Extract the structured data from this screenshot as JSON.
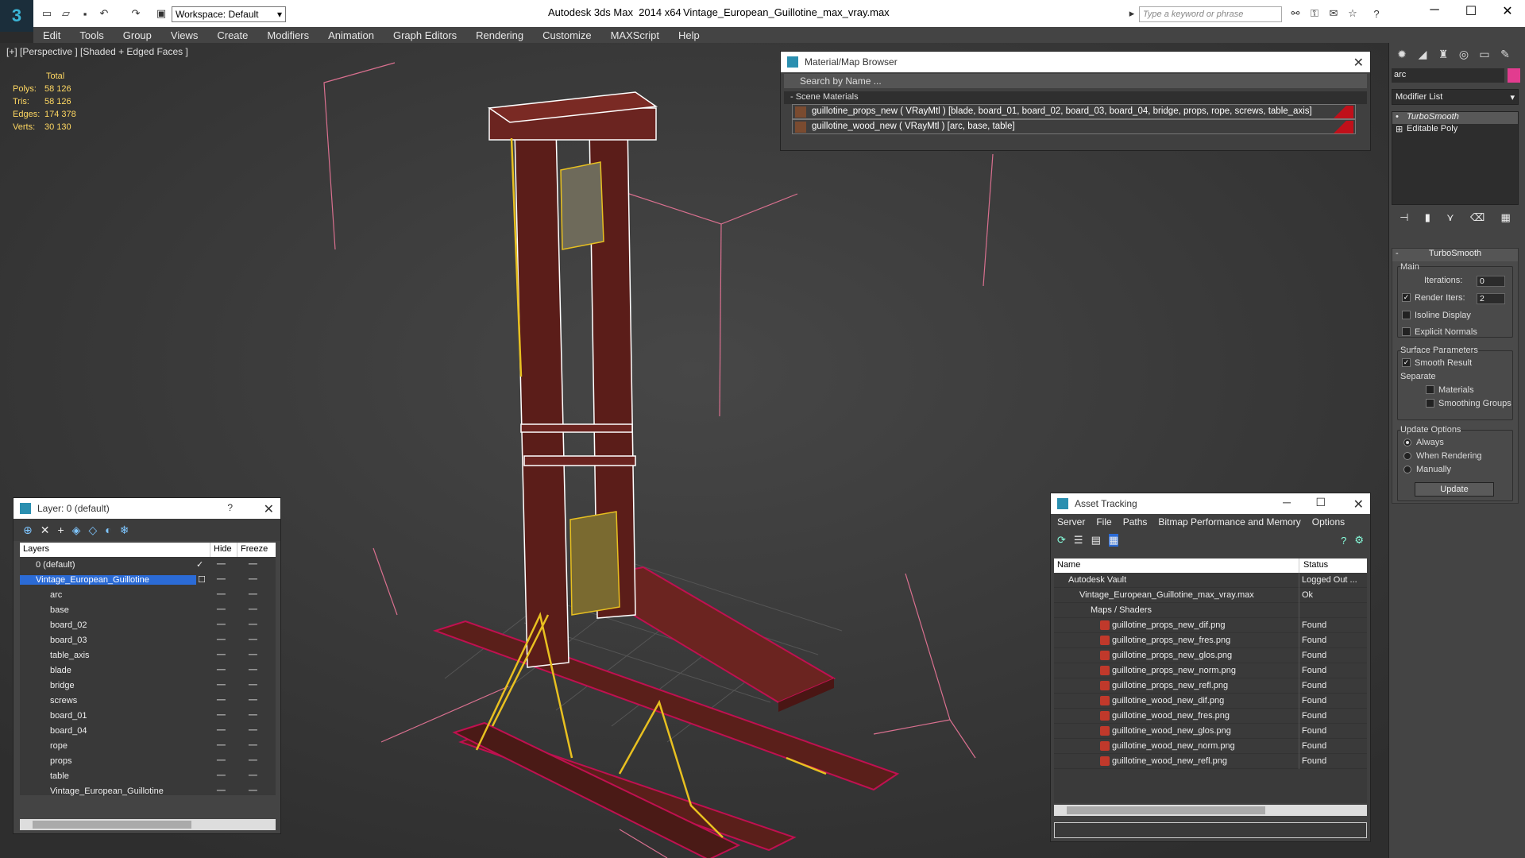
{
  "app": {
    "title": "Autodesk 3ds Max  2014 x64",
    "file": "Vintage_European_Guillotine_max_vray.max",
    "workspace": "Workspace: Default",
    "search_placeholder": "Type a keyword or phrase"
  },
  "menu": [
    "Edit",
    "Tools",
    "Group",
    "Views",
    "Create",
    "Modifiers",
    "Animation",
    "Graph Editors",
    "Rendering",
    "Customize",
    "MAXScript",
    "Help"
  ],
  "viewport": {
    "label": "[+] [Perspective ] [Shaded + Edged Faces ]",
    "stats": {
      "header": "Total",
      "rows": [
        {
          "k": "Polys:",
          "v": "58 126"
        },
        {
          "k": "Tris:",
          "v": "58 126"
        },
        {
          "k": "Edges:",
          "v": "174 378"
        },
        {
          "k": "Verts:",
          "v": "30 130"
        }
      ]
    }
  },
  "material_browser": {
    "title": "Material/Map Browser",
    "search": "Search by Name ...",
    "section": "- Scene Materials",
    "materials": [
      "guillotine_props_new  ( VRayMtl ) [blade, board_01, board_02, board_03, board_04, bridge, props, rope, screws, table_axis]",
      "guillotine_wood_new  ( VRayMtl ) [arc, base, table]"
    ]
  },
  "command_panel": {
    "object_name": "arc",
    "modifier_list": "Modifier List",
    "stack": [
      "TurboSmooth",
      "Editable Poly"
    ],
    "rollout_title": "TurboSmooth",
    "main_label": "Main",
    "iterations_label": "Iterations:",
    "iterations": "0",
    "render_iters_label": "Render Iters:",
    "render_iters": "2",
    "isoline": "Isoline Display",
    "explicit": "Explicit Normals",
    "surface_label": "Surface Parameters",
    "smooth_result": "Smooth Result",
    "separate_label": "Separate",
    "materials": "Materials",
    "smoothing_groups": "Smoothing Groups",
    "update_label": "Update Options",
    "always": "Always",
    "when_rendering": "When Rendering",
    "manually": "Manually",
    "update_button": "Update"
  },
  "layer_dialog": {
    "title": "Layer: 0 (default)",
    "help": "?",
    "col_layers": "Layers",
    "col_hide": "Hide",
    "col_freeze": "Freeze",
    "rows": [
      {
        "name": "0 (default)",
        "level": "top"
      },
      {
        "name": "Vintage_European_Guillotine",
        "level": "top",
        "selected": true
      },
      {
        "name": "arc"
      },
      {
        "name": "base"
      },
      {
        "name": "board_02"
      },
      {
        "name": "board_03"
      },
      {
        "name": "table_axis"
      },
      {
        "name": "blade"
      },
      {
        "name": "bridge"
      },
      {
        "name": "screws"
      },
      {
        "name": "board_01"
      },
      {
        "name": "board_04"
      },
      {
        "name": "rope"
      },
      {
        "name": "props"
      },
      {
        "name": "table"
      },
      {
        "name": "Vintage_European_Guillotine"
      }
    ]
  },
  "asset_tracking": {
    "title": "Asset Tracking",
    "menu": [
      "Server",
      "File",
      "Paths",
      "Bitmap Performance and Memory",
      "Options"
    ],
    "col_name": "Name",
    "col_status": "Status",
    "rows": [
      {
        "name": "Autodesk Vault",
        "status": "Logged Out ...",
        "indent": 18
      },
      {
        "name": "Vintage_European_Guillotine_max_vray.max",
        "status": "Ok",
        "indent": 32
      },
      {
        "name": "Maps / Shaders",
        "status": "",
        "indent": 46
      },
      {
        "name": "guillotine_props_new_dif.png",
        "status": "Found",
        "indent": 58
      },
      {
        "name": "guillotine_props_new_fres.png",
        "status": "Found",
        "indent": 58
      },
      {
        "name": "guillotine_props_new_glos.png",
        "status": "Found",
        "indent": 58
      },
      {
        "name": "guillotine_props_new_norm.png",
        "status": "Found",
        "indent": 58
      },
      {
        "name": "guillotine_props_new_refl.png",
        "status": "Found",
        "indent": 58
      },
      {
        "name": "guillotine_wood_new_dif.png",
        "status": "Found",
        "indent": 58
      },
      {
        "name": "guillotine_wood_new_fres.png",
        "status": "Found",
        "indent": 58
      },
      {
        "name": "guillotine_wood_new_glos.png",
        "status": "Found",
        "indent": 58
      },
      {
        "name": "guillotine_wood_new_norm.png",
        "status": "Found",
        "indent": 58
      },
      {
        "name": "guillotine_wood_new_refl.png",
        "status": "Found",
        "indent": 58
      }
    ]
  },
  "colors": {
    "accent": "#2b6bd6",
    "stat_text": "#ffd862",
    "wood": "#5a1f1a",
    "wire": "#ffffff",
    "rope": "#e8c020"
  }
}
